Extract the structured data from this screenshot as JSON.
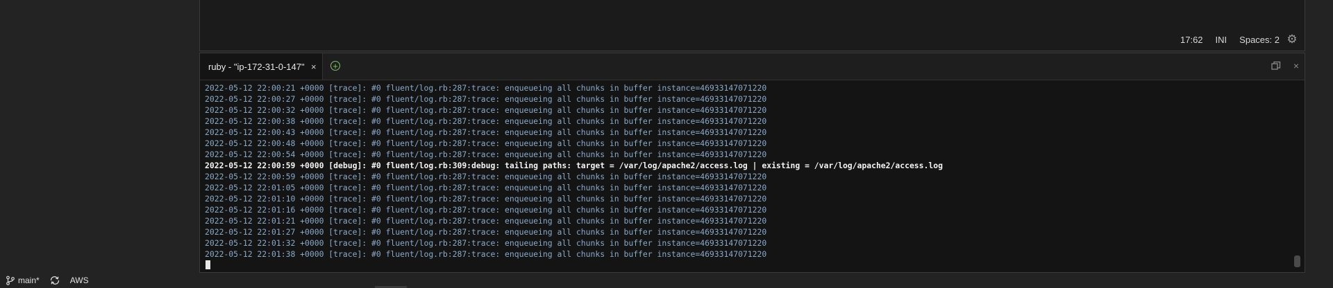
{
  "editor": {
    "status": {
      "cursor_position": "17:62",
      "language": "INI",
      "indentation": "Spaces: 2",
      "settings_icon": "gear-icon"
    }
  },
  "terminal": {
    "tab": {
      "title": "ruby - \"ip-172-31-0-147\"",
      "close_icon": "×"
    },
    "add_tab_icon": "+",
    "close_icon": "×",
    "log_lines": [
      {
        "level": "trace",
        "text": "2022-05-12 22:00:21 +0000 [trace]: #0 fluent/log.rb:287:trace: enqueueing all chunks in buffer instance=46933147071220"
      },
      {
        "level": "trace",
        "text": "2022-05-12 22:00:27 +0000 [trace]: #0 fluent/log.rb:287:trace: enqueueing all chunks in buffer instance=46933147071220"
      },
      {
        "level": "trace",
        "text": "2022-05-12 22:00:32 +0000 [trace]: #0 fluent/log.rb:287:trace: enqueueing all chunks in buffer instance=46933147071220"
      },
      {
        "level": "trace",
        "text": "2022-05-12 22:00:38 +0000 [trace]: #0 fluent/log.rb:287:trace: enqueueing all chunks in buffer instance=46933147071220"
      },
      {
        "level": "trace",
        "text": "2022-05-12 22:00:43 +0000 [trace]: #0 fluent/log.rb:287:trace: enqueueing all chunks in buffer instance=46933147071220"
      },
      {
        "level": "trace",
        "text": "2022-05-12 22:00:48 +0000 [trace]: #0 fluent/log.rb:287:trace: enqueueing all chunks in buffer instance=46933147071220"
      },
      {
        "level": "trace",
        "text": "2022-05-12 22:00:54 +0000 [trace]: #0 fluent/log.rb:287:trace: enqueueing all chunks in buffer instance=46933147071220"
      },
      {
        "level": "debug",
        "text": "2022-05-12 22:00:59 +0000 [debug]: #0 fluent/log.rb:309:debug: tailing paths: target = /var/log/apache2/access.log | existing = /var/log/apache2/access.log"
      },
      {
        "level": "trace",
        "text": "2022-05-12 22:00:59 +0000 [trace]: #0 fluent/log.rb:287:trace: enqueueing all chunks in buffer instance=46933147071220"
      },
      {
        "level": "trace",
        "text": "2022-05-12 22:01:05 +0000 [trace]: #0 fluent/log.rb:287:trace: enqueueing all chunks in buffer instance=46933147071220"
      },
      {
        "level": "trace",
        "text": "2022-05-12 22:01:10 +0000 [trace]: #0 fluent/log.rb:287:trace: enqueueing all chunks in buffer instance=46933147071220"
      },
      {
        "level": "trace",
        "text": "2022-05-12 22:01:16 +0000 [trace]: #0 fluent/log.rb:287:trace: enqueueing all chunks in buffer instance=46933147071220"
      },
      {
        "level": "trace",
        "text": "2022-05-12 22:01:21 +0000 [trace]: #0 fluent/log.rb:287:trace: enqueueing all chunks in buffer instance=46933147071220"
      },
      {
        "level": "trace",
        "text": "2022-05-12 22:01:27 +0000 [trace]: #0 fluent/log.rb:287:trace: enqueueing all chunks in buffer instance=46933147071220"
      },
      {
        "level": "trace",
        "text": "2022-05-12 22:01:32 +0000 [trace]: #0 fluent/log.rb:287:trace: enqueueing all chunks in buffer instance=46933147071220"
      },
      {
        "level": "trace",
        "text": "2022-05-12 22:01:38 +0000 [trace]: #0 fluent/log.rb:287:trace: enqueueing all chunks in buffer instance=46933147071220"
      }
    ]
  },
  "statusbar": {
    "branch": "main*",
    "branch_icon": "git-branch-icon",
    "sync_icon": "sync-icon",
    "remote": "AWS"
  },
  "colors": {
    "trace_text": "#8aa9c9",
    "debug_text": "#f4f4f4",
    "add_tab_accent": "#7cc36a"
  }
}
